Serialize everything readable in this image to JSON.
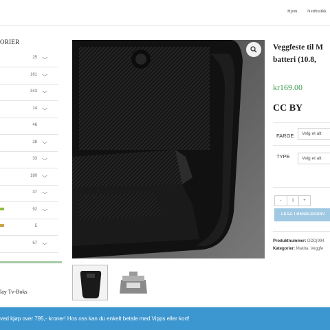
{
  "nav": {
    "links": [
      "Hjem",
      "Nettbutikk"
    ]
  },
  "sidebar": {
    "title": "ORIER",
    "categories": [
      {
        "count": "25",
        "swatch": "#ffffff"
      },
      {
        "count": "161",
        "swatch": "#ffffff"
      },
      {
        "count": "343",
        "swatch": "#ffffff"
      },
      {
        "count": "14",
        "swatch": "#ffffff"
      },
      {
        "count": "46",
        "swatch": "#ffffff"
      },
      {
        "count": "28",
        "swatch": "#ffffff"
      },
      {
        "count": "33",
        "swatch": "#ffffff"
      },
      {
        "count": "180",
        "swatch": "#ffffff"
      },
      {
        "count": "37",
        "swatch": "#ffffff"
      },
      {
        "count": "92",
        "swatch": "#8fbf3f"
      },
      {
        "count": "5",
        "swatch": "#c9a64a"
      },
      {
        "count": "57",
        "swatch": "#ffffff"
      }
    ],
    "bottom_label": "lay Tv-Boks"
  },
  "product": {
    "title": "Veggfeste til M\nbatteri (10.8,",
    "price": "kr169.00",
    "license": "CC BY",
    "options": [
      {
        "label": "FARGE",
        "placeholder": "Velg et alt"
      },
      {
        "label": "TYPE",
        "placeholder": "Velg et alt"
      }
    ],
    "qty": {
      "minus": "-",
      "value": "1",
      "plus": "+"
    },
    "add_to_cart": "LEGG I HANDLEKURV",
    "sku_label": "Produktnummer:",
    "sku_value": "DDD|994",
    "categories_label": "Kategorier:",
    "categories_value": "Makita, Veggfe"
  },
  "banner": {
    "text": "ved kjøp over 795,- kroner! Hos oss kan du enkelt betale med Vipps eller kort!"
  },
  "icons": {
    "zoom": "magnifier-icon",
    "chevron": "chevron-down-icon"
  },
  "colors": {
    "price": "#3a9b48",
    "banner": "#3c96cf",
    "add_to_cart": "#9fc8e3"
  }
}
